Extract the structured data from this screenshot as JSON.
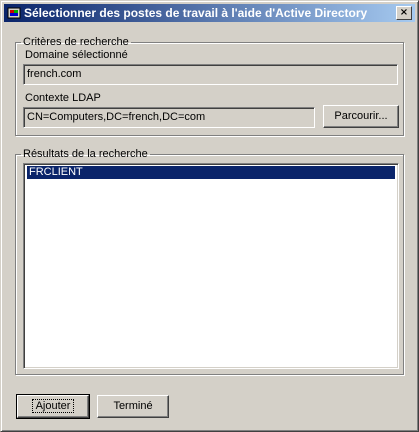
{
  "window": {
    "title": "Sélectionner des postes de travail à l'aide d'Active Directory",
    "close_glyph": "×"
  },
  "criteria": {
    "group_label": "Critères de recherche",
    "domain_label": "Domaine sélectionné",
    "domain_value": "french.com",
    "ldap_label": "Contexte LDAP",
    "ldap_value": "CN=Computers,DC=french,DC=com",
    "browse_label": "Parcourir..."
  },
  "results": {
    "group_label": "Résultats de la recherche",
    "items": [
      "FRCLIENT"
    ]
  },
  "actions": {
    "add_label": "Ajouter",
    "done_label": "Terminé"
  }
}
